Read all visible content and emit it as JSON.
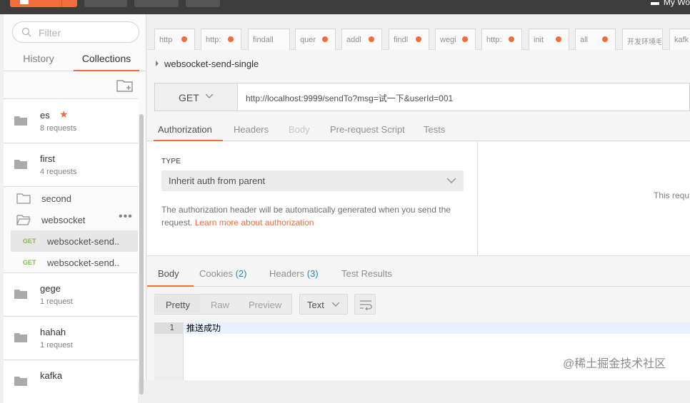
{
  "topbar": {
    "workspace_label": "My Wo"
  },
  "sidebar": {
    "filter_placeholder": "Filter",
    "tabs": {
      "history": "History",
      "collections": "Collections"
    },
    "collections": [
      {
        "name": "es",
        "count": "8 requests",
        "starred": true
      },
      {
        "name": "first",
        "count": "4 requests"
      },
      {
        "name": "second"
      },
      {
        "name": "websocket",
        "open": true,
        "requests": [
          {
            "method": "GET",
            "name": "websocket-send..",
            "selected": true
          },
          {
            "method": "GET",
            "name": "websocket-send.."
          }
        ]
      },
      {
        "name": "gege",
        "count": "1 request"
      },
      {
        "name": "hahah",
        "count": "1 request"
      },
      {
        "name": "kafka"
      }
    ]
  },
  "request_tabs": [
    "http",
    "http:",
    "findall",
    "quer",
    "addl",
    "findl",
    "wegi",
    "http:",
    "init",
    "all",
    "开发环境毛",
    "kafk"
  ],
  "request": {
    "name": "websocket-send-single",
    "method": "GET",
    "url": "http://localhost:9999/sendTo?msg=试一下&userId=001"
  },
  "req_tabs": {
    "authorization": "Authorization",
    "headers": "Headers",
    "body": "Body",
    "prescript": "Pre-request Script",
    "tests": "Tests"
  },
  "auth": {
    "type_label": "TYPE",
    "type_value": "Inherit auth from parent",
    "desc": "The authorization header will be automatically generated when you send the request.",
    "link": "Learn more about authorization",
    "right_text": "This requ"
  },
  "resp_tabs": {
    "body": "Body",
    "cookies": "Cookies",
    "cookies_count": "(2)",
    "headers": "Headers",
    "headers_count": "(3)",
    "test_results": "Test Results"
  },
  "resp_toolbar": {
    "pretty": "Pretty",
    "raw": "Raw",
    "preview": "Preview",
    "format": "Text"
  },
  "response": {
    "line": "1",
    "content": "推送成功"
  },
  "watermark": "@稀土掘金技术社区",
  "colors": {
    "accent": "#f26b3a",
    "get": "#7bc242",
    "link_blue": "#1e8ac7"
  }
}
